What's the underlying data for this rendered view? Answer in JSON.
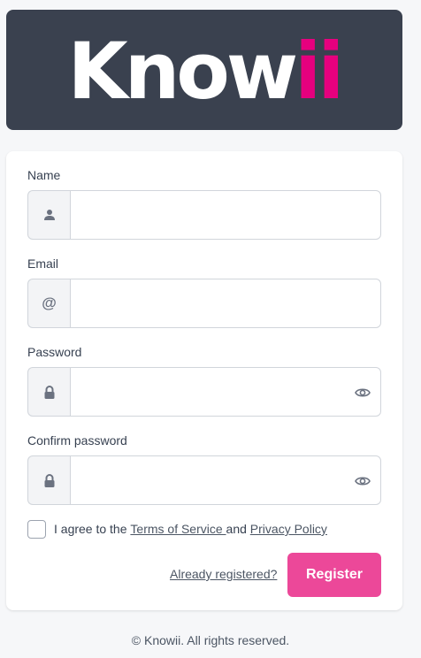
{
  "logo": {
    "main": "Know",
    "accent": "ii"
  },
  "fields": {
    "name": {
      "label": "Name",
      "value": "",
      "icon": "user-icon"
    },
    "email": {
      "label": "Email",
      "value": "",
      "icon": "at-icon",
      "icon_glyph": "@"
    },
    "password": {
      "label": "Password",
      "value": "",
      "icon": "lock-icon"
    },
    "confirm_password": {
      "label": "Confirm password",
      "value": "",
      "icon": "lock-icon"
    }
  },
  "agree": {
    "prefix": "I agree to the ",
    "terms": "Terms of Service ",
    "middle": "and ",
    "privacy": "Privacy Policy",
    "checked": false
  },
  "already_registered": "Already registered?",
  "register_button": "Register",
  "footer": "© Knowii. All rights reserved.",
  "colors": {
    "brand_accent": "#e6007e",
    "button": "#ec4899",
    "banner": "#3a414f"
  }
}
